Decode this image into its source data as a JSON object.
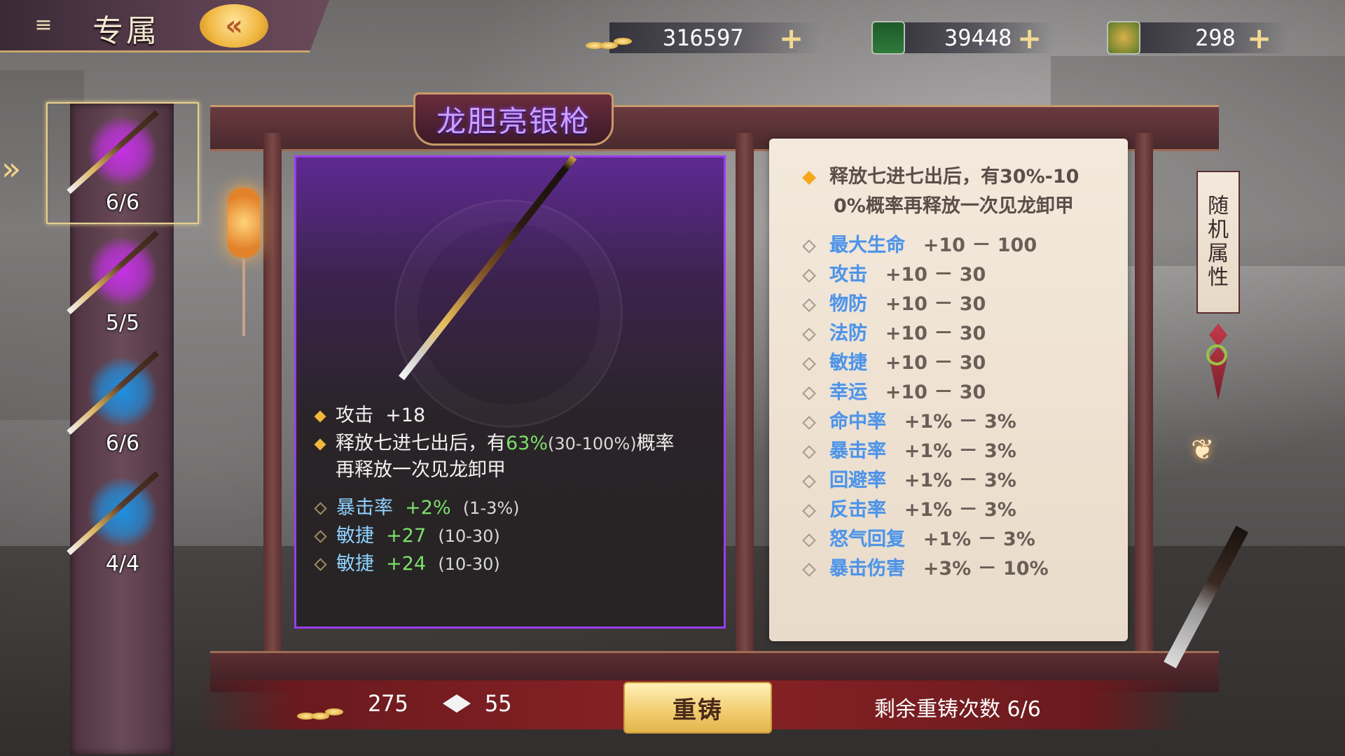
{
  "header": {
    "title": "专属",
    "menu_icon": "menu-icon",
    "back_icon": "back-arrow-icon"
  },
  "resources": [
    {
      "name": "gold",
      "icon": "gold-coins-icon",
      "value": "316597",
      "plus": "+"
    },
    {
      "name": "gem",
      "icon": "gem-icon",
      "value": "39448",
      "plus": "+"
    },
    {
      "name": "pouch",
      "icon": "pouch-icon",
      "value": "298",
      "plus": "+"
    }
  ],
  "weapon_list": [
    {
      "count": "6/6",
      "orb_color": "#c430e6",
      "selected": true
    },
    {
      "count": "5/5",
      "orb_color": "#c430e6",
      "selected": false
    },
    {
      "count": "6/6",
      "orb_color": "#1e8fe0",
      "selected": false
    },
    {
      "count": "4/4",
      "orb_color": "#1e8fe0",
      "selected": false
    }
  ],
  "item": {
    "name": "龙胆亮银枪",
    "base_stat": {
      "label": "攻击",
      "value": "+18"
    },
    "effect": {
      "prefix": "释放七进七出后，有",
      "chance": "63%",
      "range": "(30-100%)",
      "suffix1": "概率",
      "line2": "再释放一次见龙卸甲"
    },
    "random_stats": [
      {
        "name": "暴击率",
        "value": "+2%",
        "range": "(1-3%)"
      },
      {
        "name": "敏捷",
        "value": "+27",
        "range": "(10-30)"
      },
      {
        "name": "敏捷",
        "value": "+24",
        "range": "(10-30)"
      }
    ]
  },
  "scroll": {
    "effect_line1": "释放七进七出后，有30%-10",
    "effect_line2": "0%概率再释放一次见龙卸甲",
    "attributes": [
      {
        "name": "最大生命",
        "range": "+10 － 100"
      },
      {
        "name": "攻击",
        "range": "+10 － 30"
      },
      {
        "name": "物防",
        "range": "+10 － 30"
      },
      {
        "name": "法防",
        "range": "+10 － 30"
      },
      {
        "name": "敏捷",
        "range": "+10 － 30"
      },
      {
        "name": "幸运",
        "range": "+10 － 30"
      },
      {
        "name": "命中率",
        "range": "+1% － 3%"
      },
      {
        "name": "暴击率",
        "range": "+1% － 3%"
      },
      {
        "name": "回避率",
        "range": "+1% － 3%"
      },
      {
        "name": "反击率",
        "range": "+1% － 3%"
      },
      {
        "name": "怒气回复",
        "range": "+1% － 3%"
      },
      {
        "name": "暴击伤害",
        "range": "+3% － 10%"
      }
    ]
  },
  "side_tag": [
    "随",
    "机",
    "属",
    "性"
  ],
  "bottom": {
    "coin_cost": "275",
    "gem_cost": "55",
    "reforge_label": "重铸",
    "remaining": "剩余重铸次数 6/6"
  },
  "colors": {
    "accent_gold": "#f1cc6e",
    "item_border_purple": "#9b3cf0",
    "stat_green": "#7de06a",
    "stat_blue": "#8fd2ff",
    "scroll_attr_blue": "#4f94e6"
  }
}
